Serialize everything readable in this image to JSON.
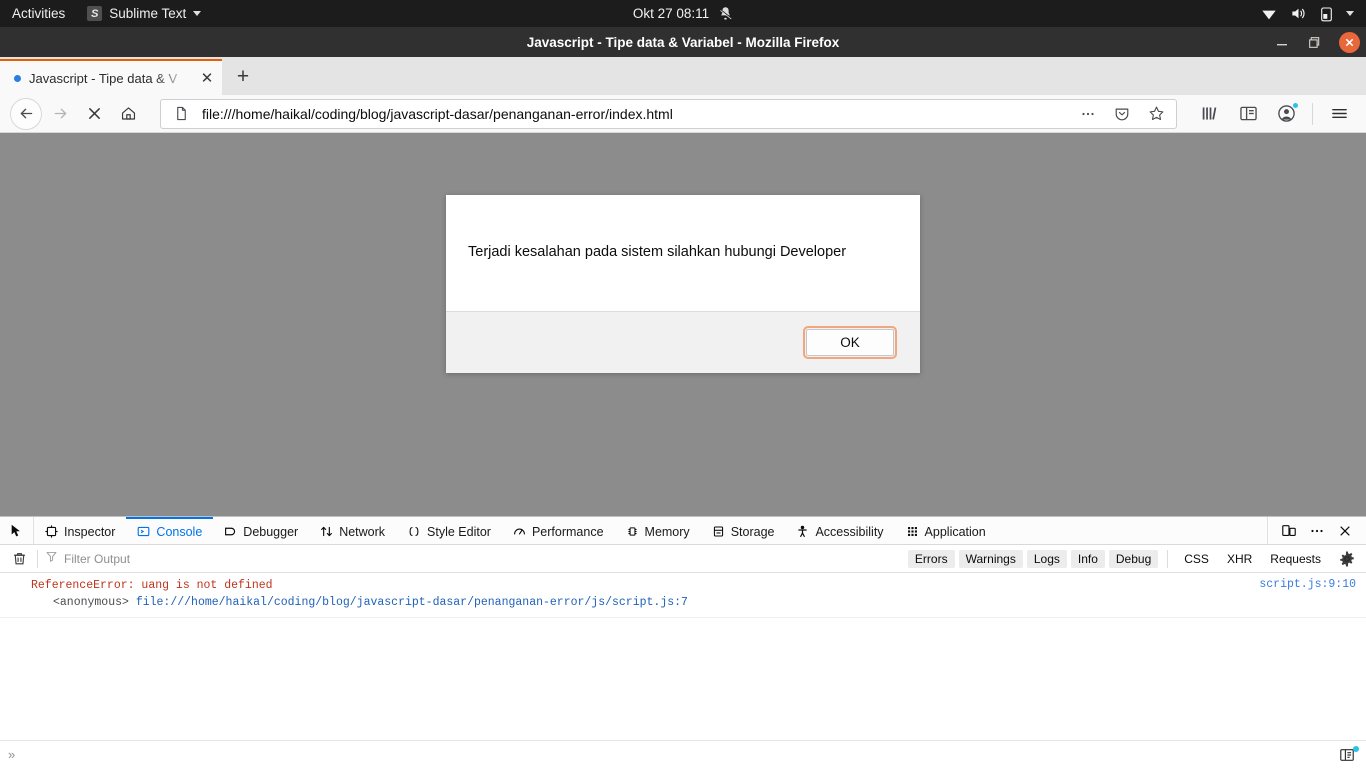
{
  "desktop": {
    "activities": "Activities",
    "app_menu": {
      "label": "Sublime Text",
      "icon": "sublime-text-icon"
    },
    "clock": "Okt 27  08:11",
    "notifications_icon": "bell-muted-icon",
    "tray": [
      "wifi-icon",
      "volume-icon",
      "battery-icon",
      "chevron-down-icon"
    ]
  },
  "window": {
    "title": "Javascript - Tipe data & Variabel - Mozilla Firefox",
    "controls": {
      "minimize": "minimize-icon",
      "maximize": "maximize-icon",
      "close": "close-icon"
    }
  },
  "tabs": {
    "items": [
      {
        "label": "Javascript - Tipe data & V",
        "favicon": "blue-dot-favicon",
        "active": true
      }
    ],
    "new_tab_label": "+",
    "close_label": "✕"
  },
  "navbar": {
    "back": "back-icon",
    "forward": "forward-icon",
    "stop": "stop-icon",
    "home": "home-icon",
    "url": "file:///home/haikal/coding/blog/javascript-dasar/penanganan-error/index.html",
    "page_icon": "document-icon",
    "page_actions": "ellipsis-icon",
    "pocket": "pocket-icon",
    "bookmark": "star-icon",
    "library": "library-icon",
    "sidebar": "sidebar-icon",
    "account": "account-icon",
    "menu": "hamburger-menu-icon"
  },
  "page": {
    "background_color": "#8c8c8c"
  },
  "dialog": {
    "message": "Terjadi kesalahan pada sistem silahkan hubungi Developer",
    "ok_label": "OK",
    "focus_ring_color": "#f0a67e"
  },
  "devtools": {
    "picker_icon": "element-picker-icon",
    "tabs": [
      {
        "label": "Inspector",
        "icon": "inspector-icon",
        "active": false
      },
      {
        "label": "Console",
        "icon": "console-icon",
        "active": true
      },
      {
        "label": "Debugger",
        "icon": "debugger-icon",
        "active": false
      },
      {
        "label": "Network",
        "icon": "network-icon",
        "active": false
      },
      {
        "label": "Style Editor",
        "icon": "style-editor-icon",
        "active": false
      },
      {
        "label": "Performance",
        "icon": "performance-icon",
        "active": false
      },
      {
        "label": "Memory",
        "icon": "memory-icon",
        "active": false
      },
      {
        "label": "Storage",
        "icon": "storage-icon",
        "active": false
      },
      {
        "label": "Accessibility",
        "icon": "accessibility-icon",
        "active": false
      },
      {
        "label": "Application",
        "icon": "application-icon",
        "active": false
      }
    ],
    "right_buttons": [
      "responsive-design-mode-icon",
      "devtools-meatball-menu-icon",
      "devtools-close-icon"
    ],
    "accent_color": "#0074e8",
    "filter_bar": {
      "clear_icon": "trash-icon",
      "filter_icon": "funnel-icon",
      "filter_placeholder": "Filter Output",
      "pills": [
        {
          "label": "Errors",
          "active": true
        },
        {
          "label": "Warnings",
          "active": true
        },
        {
          "label": "Logs",
          "active": true
        },
        {
          "label": "Info",
          "active": true
        },
        {
          "label": "Debug",
          "active": true
        },
        {
          "label": "CSS",
          "active": false
        },
        {
          "label": "XHR",
          "active": false
        },
        {
          "label": "Requests",
          "active": false
        }
      ],
      "settings_icon": "gear-icon"
    },
    "console_messages": [
      {
        "title": "ReferenceError: uang is not defined",
        "frame_name": "<anonymous>",
        "frame_location": "file:///home/haikal/coding/blog/javascript-dasar/penanganan-error/js/script.js:7",
        "source": "script.js:9:10",
        "level_color": "#c0341d"
      }
    ],
    "input": {
      "prompt": "»",
      "value": "",
      "editor_toggle_icon": "editor-mode-icon"
    }
  }
}
